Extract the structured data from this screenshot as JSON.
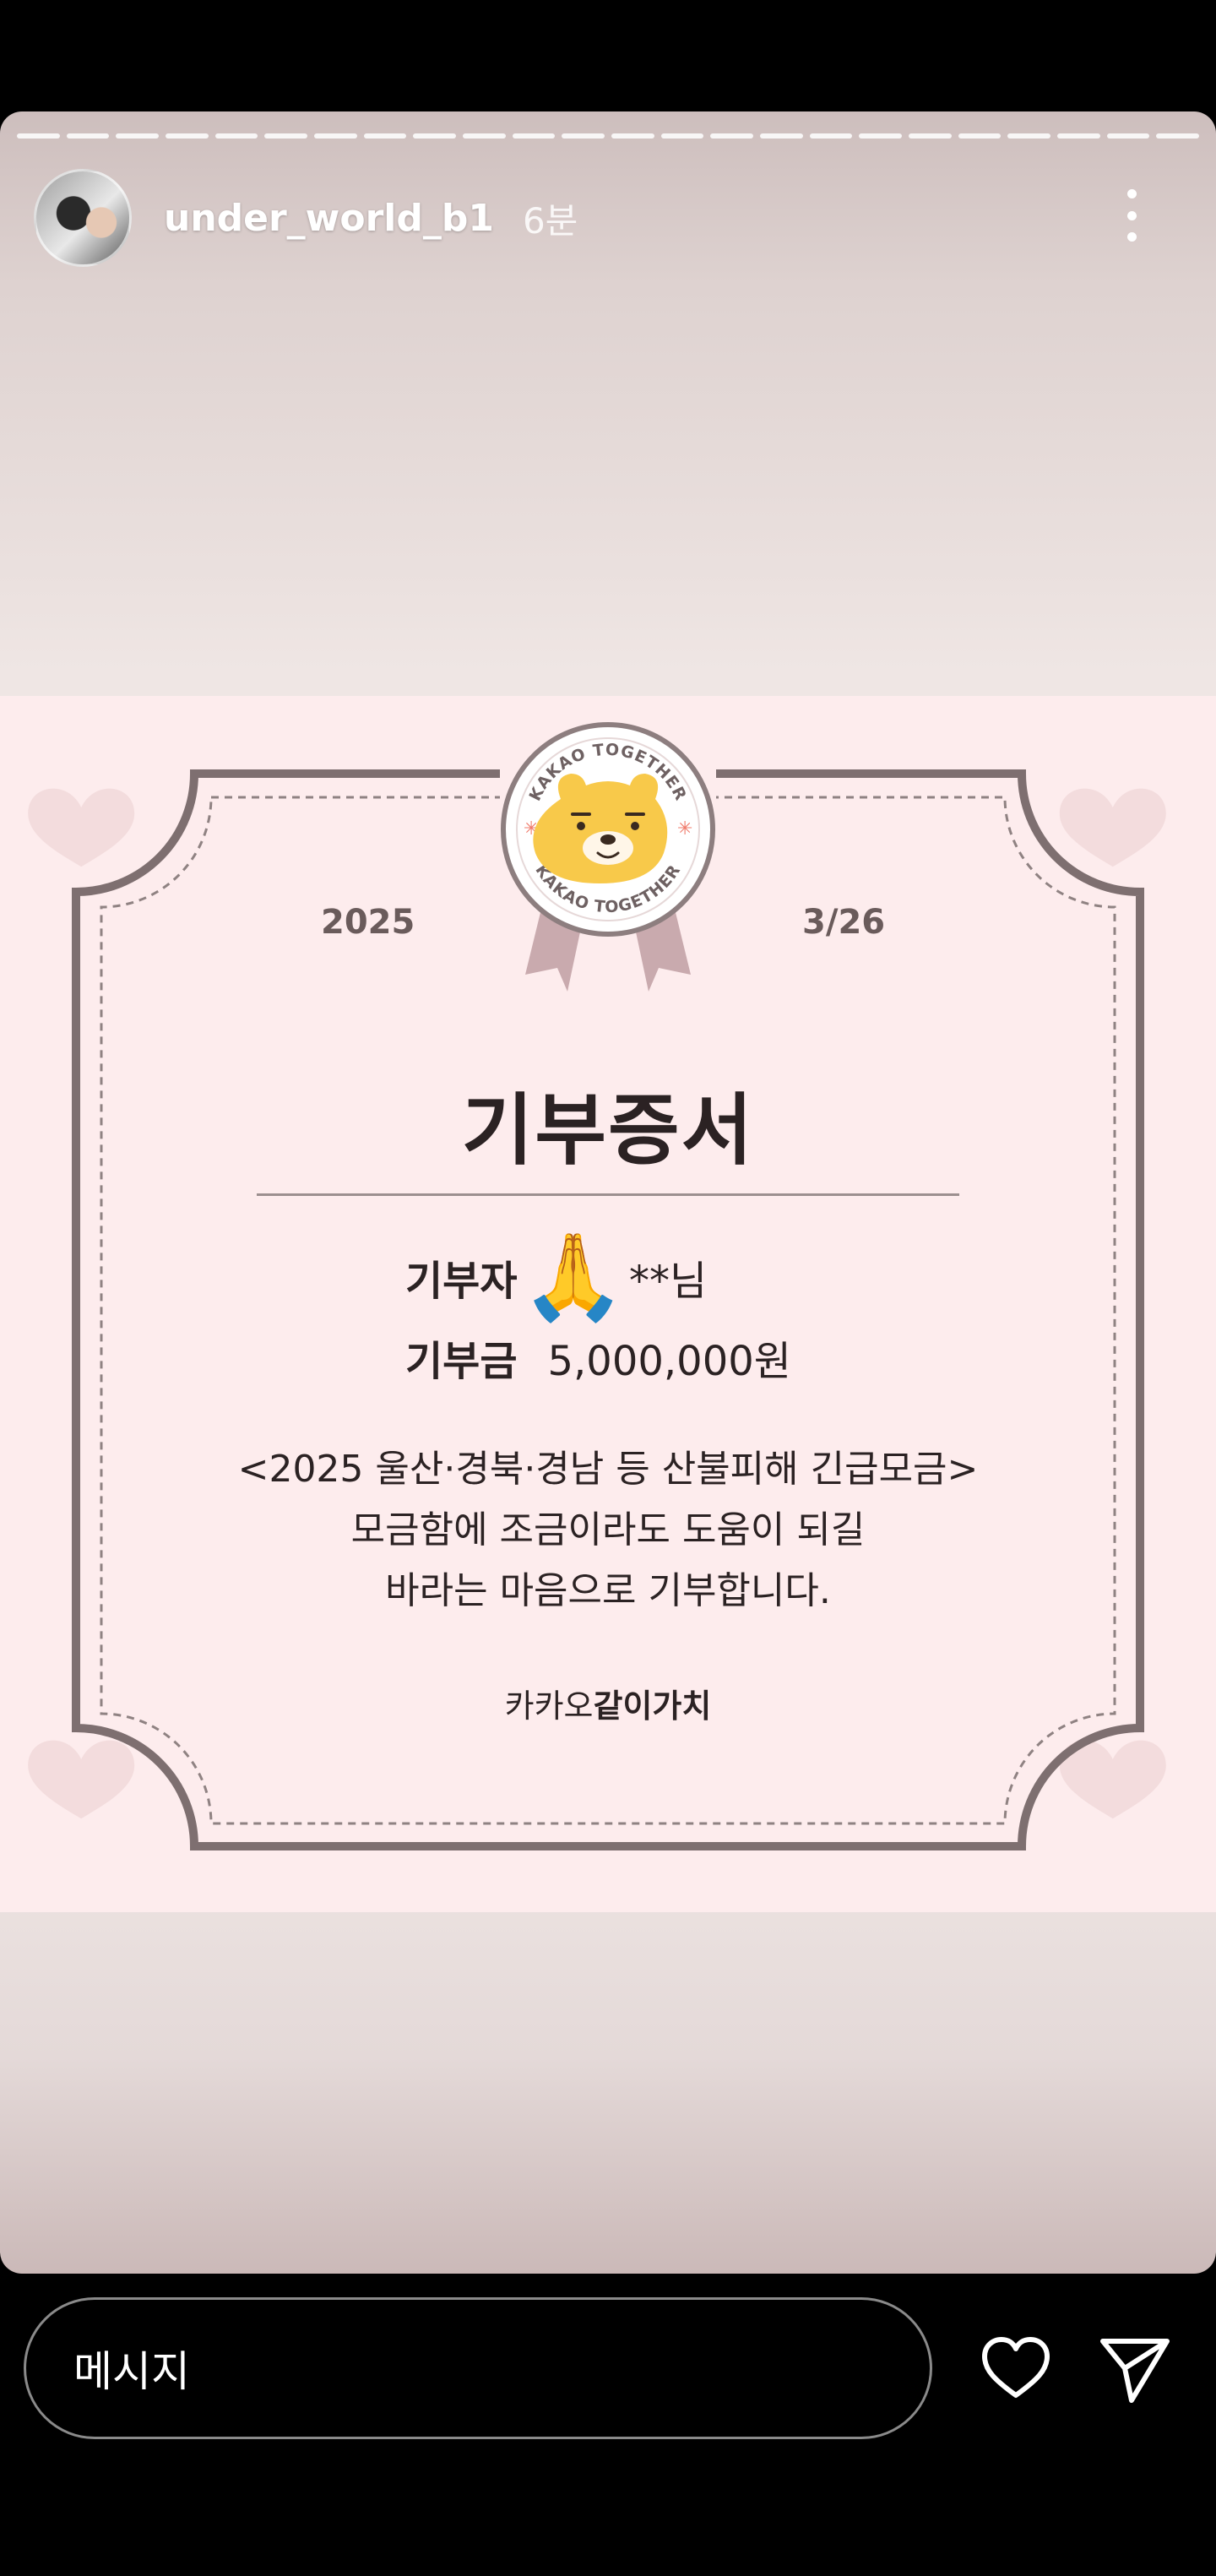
{
  "story": {
    "progress_segments": 24,
    "username": "under_world_b1",
    "time_ago": "6분"
  },
  "certificate": {
    "badge_text": "KAKAO TOGETHER",
    "year": "2025",
    "date": "3/26",
    "title": "기부증서",
    "donor_label": "기부자",
    "donor_emoji": "🙏",
    "donor_suffix": "**님",
    "amount_label": "기부금",
    "amount_value": "5,000,000원",
    "message_lines": [
      "<2025 울산·경북·경남 등 산불피해 긴급모금>",
      "모금함에 조금이라도 도움이 되길",
      "바라는 마음으로 기부합니다."
    ],
    "brand_light": "카카오",
    "brand_bold": "같이가치",
    "colors": {
      "background": "#fdeced",
      "frame": "#7e6f70",
      "badge_face": "#f8c94a",
      "ribbon": "#c9aaae"
    }
  },
  "bottom": {
    "message_placeholder": "메시지",
    "icons": [
      "heart-icon",
      "send-icon"
    ]
  }
}
